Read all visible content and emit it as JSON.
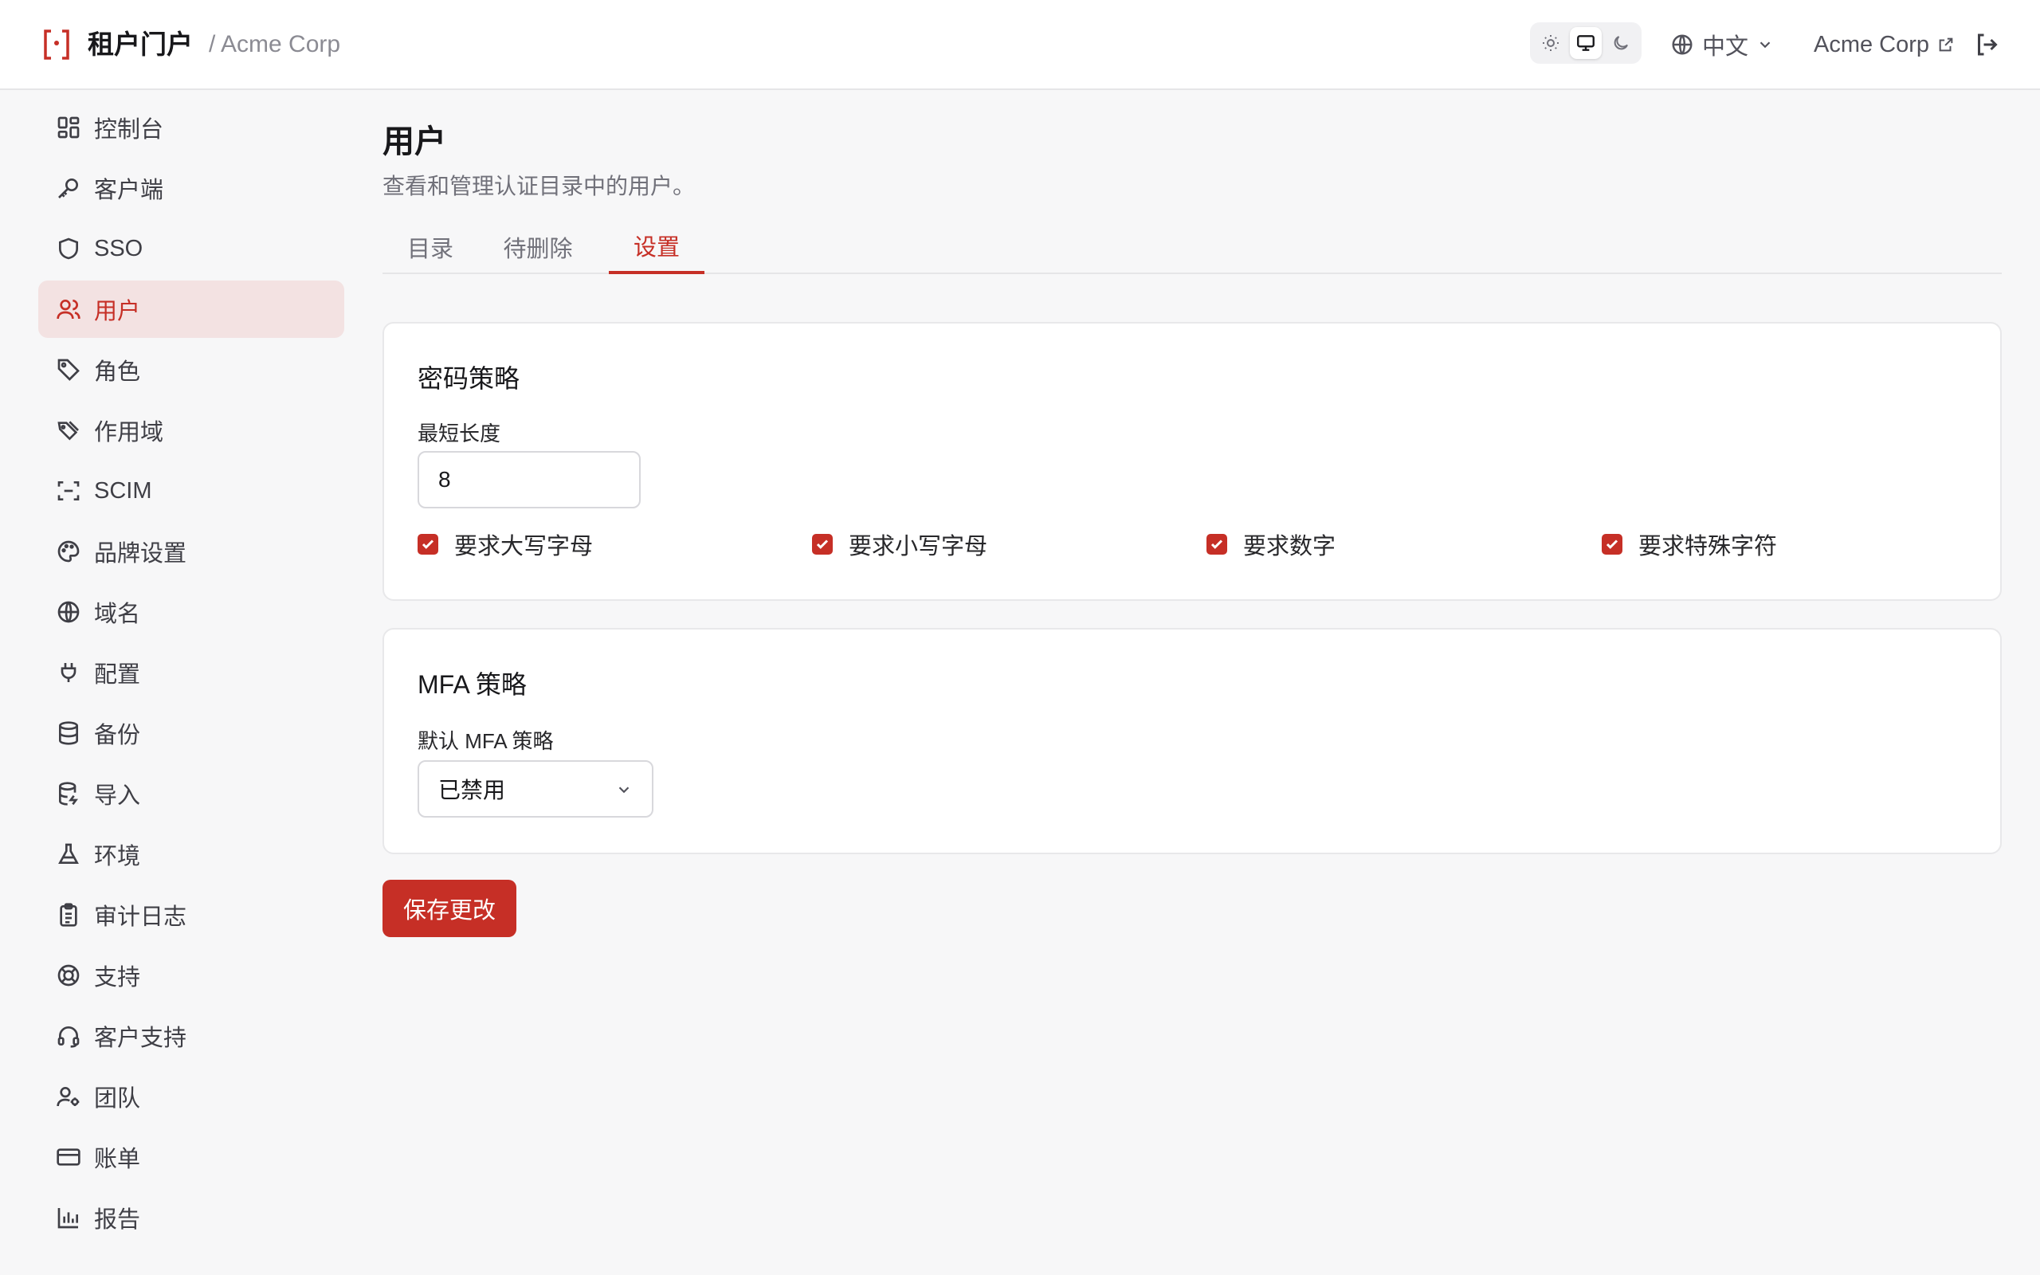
{
  "header": {
    "brand_title": "租户门户",
    "org_crumb": "/ Acme Corp",
    "language": "中文",
    "org_link": "Acme Corp",
    "theme_options": [
      "sun-icon",
      "monitor-icon",
      "moon-icon"
    ],
    "active_theme": "monitor-icon"
  },
  "sidebar": {
    "items": [
      {
        "label": "控制台",
        "icon": "dashboard-icon"
      },
      {
        "label": "客户端",
        "icon": "key-icon"
      },
      {
        "label": "SSO",
        "icon": "shield-icon"
      },
      {
        "label": "用户",
        "icon": "users-icon",
        "active": true
      },
      {
        "label": "角色",
        "icon": "tag-icon"
      },
      {
        "label": "作用域",
        "icon": "tags-icon"
      },
      {
        "label": "SCIM",
        "icon": "scan-icon"
      },
      {
        "label": "品牌设置",
        "icon": "palette-icon"
      },
      {
        "label": "域名",
        "icon": "globe-icon"
      },
      {
        "label": "配置",
        "icon": "plug-icon"
      },
      {
        "label": "备份",
        "icon": "database-icon"
      },
      {
        "label": "导入",
        "icon": "database-import-icon"
      },
      {
        "label": "环境",
        "icon": "flask-icon"
      },
      {
        "label": "审计日志",
        "icon": "clipboard-icon"
      },
      {
        "label": "支持",
        "icon": "lifebuoy-icon"
      },
      {
        "label": "客户支持",
        "icon": "headset-icon"
      },
      {
        "label": "团队",
        "icon": "user-cog-icon"
      },
      {
        "label": "账单",
        "icon": "credit-card-icon"
      },
      {
        "label": "报告",
        "icon": "bar-chart-icon"
      }
    ]
  },
  "page": {
    "title": "用户",
    "description": "查看和管理认证目录中的用户。",
    "tabs": [
      {
        "label": "目录"
      },
      {
        "label": "待删除"
      },
      {
        "label": "设置",
        "active": true
      }
    ]
  },
  "password_policy": {
    "title": "密码策略",
    "min_length_label": "最短长度",
    "min_length_value": "8",
    "checks": [
      {
        "label": "要求大写字母",
        "checked": true
      },
      {
        "label": "要求小写字母",
        "checked": true
      },
      {
        "label": "要求数字",
        "checked": true
      },
      {
        "label": "要求特殊字符",
        "checked": true
      }
    ]
  },
  "mfa_policy": {
    "title": "MFA 策略",
    "default_label": "默认 MFA 策略",
    "default_value": "已禁用"
  },
  "actions": {
    "save_label": "保存更改"
  },
  "colors": {
    "accent": "#c62f26",
    "active_nav_bg": "#f3e2e2"
  }
}
